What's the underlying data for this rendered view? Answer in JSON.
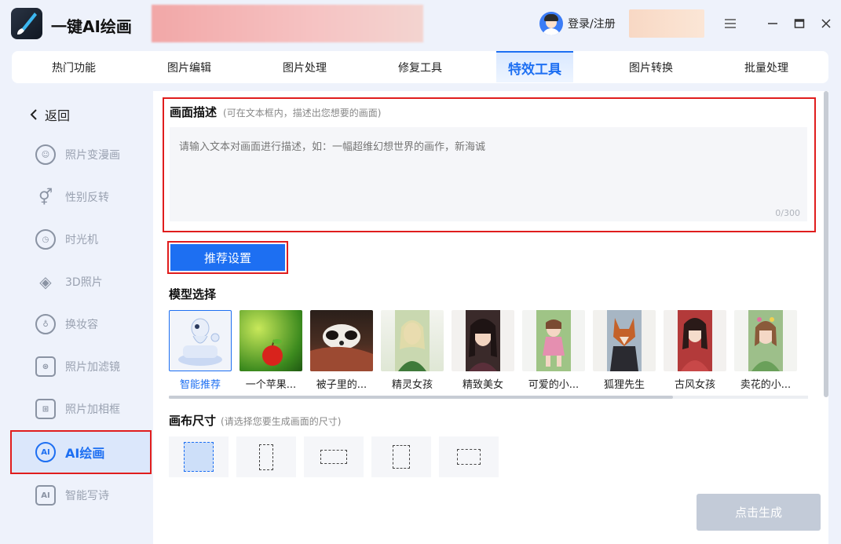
{
  "app": {
    "title": "一键AI绘画"
  },
  "header": {
    "login_label": "登录/注册"
  },
  "tabs": [
    {
      "label": "热门功能"
    },
    {
      "label": "图片编辑"
    },
    {
      "label": "图片处理"
    },
    {
      "label": "修复工具"
    },
    {
      "label": "特效工具",
      "active": true
    },
    {
      "label": "图片转换"
    },
    {
      "label": "批量处理"
    }
  ],
  "sidebar": {
    "back_label": "返回",
    "items": [
      {
        "label": "照片变漫画",
        "icon": "face-icon"
      },
      {
        "label": "性别反转",
        "icon": "gender-icon"
      },
      {
        "label": "时光机",
        "icon": "clock-icon"
      },
      {
        "label": "3D照片",
        "icon": "layers-icon"
      },
      {
        "label": "换妆容",
        "icon": "makeup-icon"
      },
      {
        "label": "照片加滤镜",
        "icon": "filter-icon"
      },
      {
        "label": "照片加相框",
        "icon": "frame-icon"
      },
      {
        "label": "AI绘画",
        "icon": "ai-paint-icon",
        "active": true
      },
      {
        "label": "智能写诗",
        "icon": "ai-poem-icon"
      }
    ]
  },
  "description": {
    "title": "画面描述",
    "hint": "(可在文本框内，描述出您想要的画面)",
    "placeholder": "请输入文本对画面进行描述，如：一幅超维幻想世界的画作，新海诚",
    "counter": "0/300"
  },
  "recommend_button": "推荐设置",
  "models": {
    "title": "模型选择",
    "items": [
      {
        "label": "智能推荐",
        "active": true
      },
      {
        "label": "一个苹果..."
      },
      {
        "label": "被子里的..."
      },
      {
        "label": "精灵女孩"
      },
      {
        "label": "精致美女"
      },
      {
        "label": "可爱的小..."
      },
      {
        "label": "狐狸先生"
      },
      {
        "label": "古风女孩"
      },
      {
        "label": "卖花的小..."
      }
    ]
  },
  "canvas_size": {
    "title": "画布尺寸",
    "hint": "(请选择您要生成画面的尺寸)",
    "options": [
      {
        "shape": "square",
        "active": true
      },
      {
        "shape": "portrait-tall"
      },
      {
        "shape": "landscape-wide"
      },
      {
        "shape": "portrait"
      },
      {
        "shape": "landscape"
      }
    ]
  },
  "generate_button": "点击生成",
  "colors": {
    "accent": "#1d6ff2",
    "highlight_border": "#e01d1d",
    "disabled": "#c3cbd8"
  }
}
